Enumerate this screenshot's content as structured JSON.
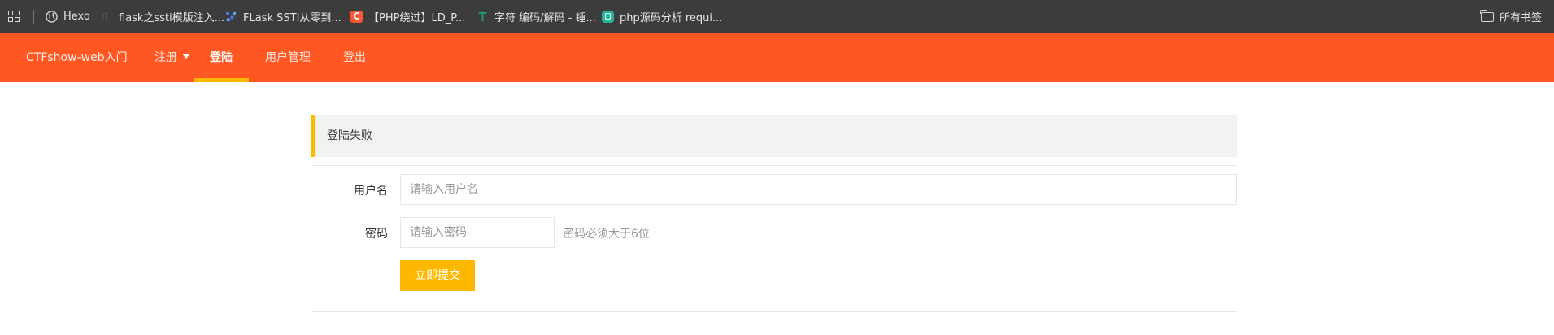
{
  "bookmarks": {
    "items": [
      {
        "label": "Hexo",
        "icon": "globe-icon"
      },
      {
        "label": "flask之ssti模版注入...",
        "icon": "flask-site-icon"
      },
      {
        "label": "FLask SSTI从零到...",
        "icon": "csdn-blog-icon"
      },
      {
        "label": "【PHP绕过】LD_P...",
        "icon": "csdn-c-icon"
      },
      {
        "label": "字符 编码/解码 - 锤...",
        "icon": "tool-icon"
      },
      {
        "label": "php源码分析 requi...",
        "icon": "blog-icon"
      }
    ],
    "all_bookmarks": "所有书签"
  },
  "nav": {
    "brand": "CTFshow-web入门",
    "items": [
      {
        "label": "注册",
        "has_dropdown": true
      },
      {
        "label": "登陆",
        "active": true
      },
      {
        "label": "用户管理"
      },
      {
        "label": "登出"
      }
    ],
    "accent_color": "#ff5722",
    "active_indicator_color": "#ffb800"
  },
  "alert": {
    "message": "登陆失败"
  },
  "form": {
    "username_label": "用户名",
    "username_placeholder": "请输入用户名",
    "password_label": "密码",
    "password_placeholder": "请输入密码",
    "password_hint": "密码必须大于6位",
    "submit_label": "立即提交"
  }
}
